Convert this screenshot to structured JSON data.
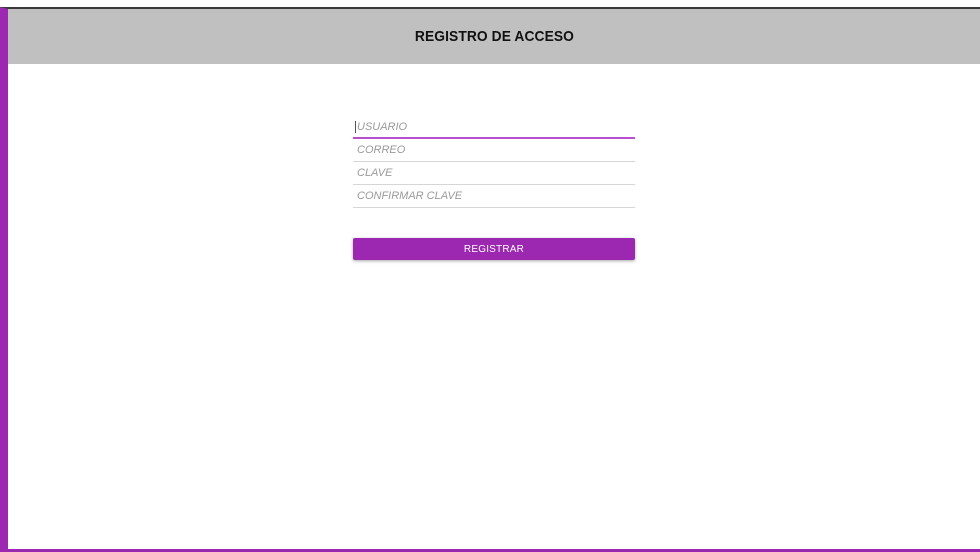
{
  "header": {
    "title": "REGISTRO DE ACCESO"
  },
  "form": {
    "fields": [
      {
        "placeholder": "USUARIO",
        "value": ""
      },
      {
        "placeholder": "CORREO",
        "value": ""
      },
      {
        "placeholder": "CLAVE",
        "value": ""
      },
      {
        "placeholder": "CONFIRMAR CLAVE",
        "value": ""
      }
    ],
    "submit_label": "REGISTRAR"
  },
  "colors": {
    "accent": "#9c27b0",
    "header_bg": "#c0c0c0"
  }
}
